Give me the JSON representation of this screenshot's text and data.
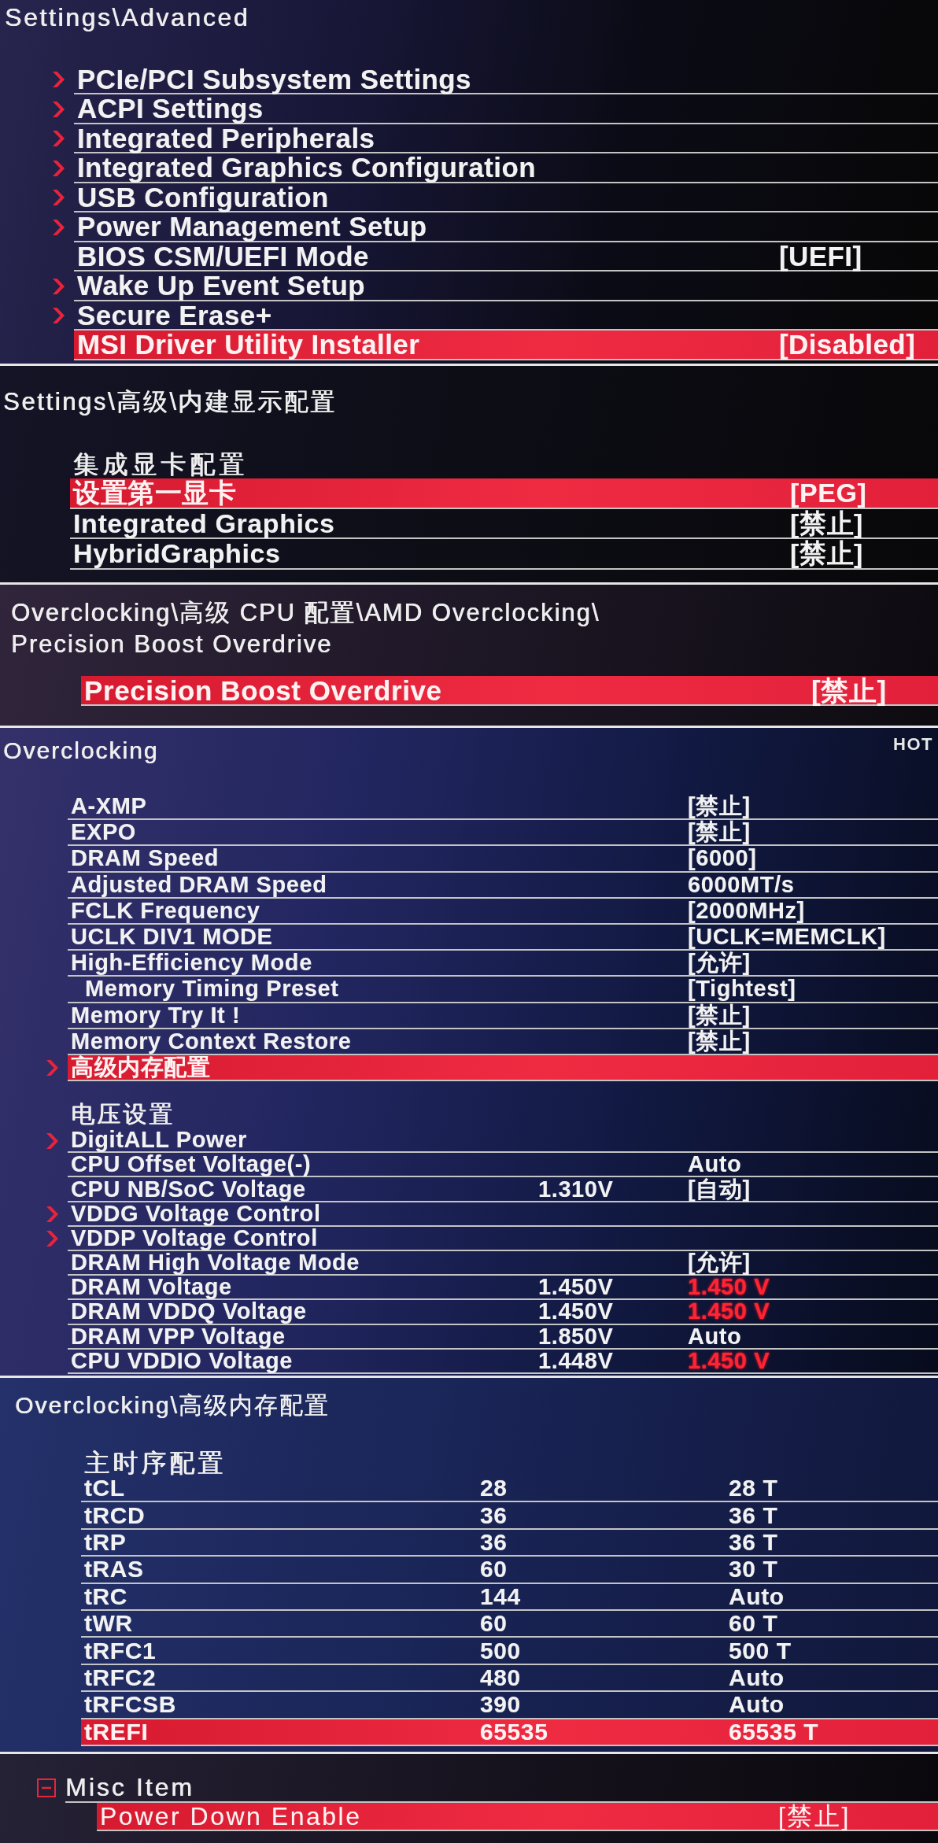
{
  "panels": [
    {
      "title_lines": [
        "Settings\\Advanced"
      ],
      "sections": [
        {
          "rows": [
            {
              "label": "PCIe/PCI Subsystem Settings",
              "submenu": true,
              "selected": false
            },
            {
              "label": "ACPI Settings",
              "submenu": true,
              "selected": false
            },
            {
              "label": "Integrated Peripherals",
              "submenu": true,
              "selected": false
            },
            {
              "label": "Integrated Graphics Configuration",
              "submenu": true,
              "selected": false
            },
            {
              "label": "USB Configuration",
              "submenu": true,
              "selected": false
            },
            {
              "label": "Power Management Setup",
              "submenu": true,
              "selected": false
            },
            {
              "label": "BIOS CSM/UEFI Mode",
              "submenu": false,
              "value": "[UEFI]",
              "selected": false
            },
            {
              "label": "Wake Up Event Setup",
              "submenu": true,
              "selected": false
            },
            {
              "label": "Secure Erase+",
              "submenu": true,
              "selected": false
            },
            {
              "label": "MSI Driver Utility Installer",
              "submenu": false,
              "value": "[Disabled]",
              "selected": true
            }
          ]
        }
      ]
    },
    {
      "title_lines": [
        "Settings\\高级\\内建显示配置"
      ],
      "sections": [
        {
          "heading": "集成显卡配置",
          "rows": [
            {
              "label": "设置第一显卡",
              "value": "[PEG]",
              "selected": true
            },
            {
              "label": "Integrated Graphics",
              "value": "[禁止]",
              "selected": false
            },
            {
              "label": "HybridGraphics",
              "value": "[禁止]",
              "selected": false
            }
          ]
        }
      ]
    },
    {
      "title_lines": [
        "Overclocking\\高级 CPU 配置\\AMD Overclocking\\",
        "Precision Boost Overdrive"
      ],
      "sections": [
        {
          "rows": [
            {
              "label": "Precision Boost Overdrive",
              "value": "[禁止]",
              "selected": true
            }
          ]
        }
      ]
    },
    {
      "title_lines": [
        "Overclocking"
      ],
      "badge": "HOT",
      "sections": [
        {
          "rows": [
            {
              "label": "A-XMP",
              "submenu": false,
              "value": "[禁止]",
              "selected": false
            },
            {
              "label": "EXPO",
              "submenu": false,
              "value": "[禁止]",
              "selected": false
            },
            {
              "label": "DRAM Speed",
              "submenu": false,
              "value": "[6000]",
              "selected": false
            },
            {
              "label": "Adjusted DRAM Speed",
              "submenu": false,
              "value": "6000MT/s",
              "selected": false
            },
            {
              "label": "FCLK Frequency",
              "submenu": false,
              "value": "[2000MHz]",
              "selected": false
            },
            {
              "label": "UCLK DIV1 MODE",
              "submenu": false,
              "value": "[UCLK=MEMCLK]",
              "selected": false
            },
            {
              "label": "High-Efficiency Mode",
              "submenu": false,
              "value": "[允许]",
              "selected": false,
              "children": [
                {
                  "label": "Memory Timing Preset",
                  "submenu": false,
                  "value": "[Tightest]",
                  "selected": false
                }
              ]
            },
            {
              "label": "Memory Try It !",
              "submenu": false,
              "value": "[禁止]",
              "selected": false
            },
            {
              "label": "Memory Context Restore",
              "submenu": false,
              "value": "[禁止]",
              "selected": false
            },
            {
              "label": "高级内存配置",
              "submenu": true,
              "selected": true
            }
          ]
        },
        {
          "heading": "电压设置",
          "rows": [
            {
              "label": "DigitALL Power",
              "submenu": true,
              "selected": false
            },
            {
              "label": "CPU Offset Voltage(-)",
              "submenu": false,
              "value": "Auto",
              "selected": false,
              "alert": false
            },
            {
              "label": "CPU NB/SoC Voltage",
              "submenu": false,
              "reading": "1.310V",
              "value": "[自动]",
              "selected": false,
              "alert": false
            },
            {
              "label": "VDDG Voltage Control",
              "submenu": true,
              "selected": false
            },
            {
              "label": "VDDP Voltage Control",
              "submenu": true,
              "selected": false
            },
            {
              "label": "DRAM High Voltage Mode",
              "submenu": false,
              "value": "[允许]",
              "selected": false,
              "alert": false
            },
            {
              "label": "DRAM Voltage",
              "submenu": false,
              "reading": "1.450V",
              "value": "1.450 V",
              "selected": false,
              "alert": true
            },
            {
              "label": "DRAM VDDQ Voltage",
              "submenu": false,
              "reading": "1.450V",
              "value": "1.450 V",
              "selected": false,
              "alert": true
            },
            {
              "label": "DRAM VPP Voltage",
              "submenu": false,
              "reading": "1.850V",
              "value": "Auto",
              "selected": false,
              "alert": false
            },
            {
              "label": "CPU VDDIO Voltage",
              "submenu": false,
              "reading": "1.448V",
              "value": "1.450 V",
              "selected": false,
              "alert": true
            }
          ]
        }
      ]
    },
    {
      "title_lines": [
        "Overclocking\\高级内存配置"
      ],
      "sections": [
        {
          "heading": "主时序配置",
          "rows": [
            {
              "label": "tCL",
              "reading": "28",
              "value": "28 T",
              "selected": false
            },
            {
              "label": "tRCD",
              "reading": "36",
              "value": "36 T",
              "selected": false
            },
            {
              "label": "tRP",
              "reading": "36",
              "value": "36 T",
              "selected": false
            },
            {
              "label": "tRAS",
              "reading": "60",
              "value": "30 T",
              "selected": false
            },
            {
              "label": "tRC",
              "reading": "144",
              "value": "Auto",
              "selected": false
            },
            {
              "label": "tWR",
              "reading": "60",
              "value": "60 T",
              "selected": false
            },
            {
              "label": "tRFC1",
              "reading": "500",
              "value": "500 T",
              "selected": false
            },
            {
              "label": "tRFC2",
              "reading": "480",
              "value": "Auto",
              "selected": false
            },
            {
              "label": "tRFCSB",
              "reading": "390",
              "value": "Auto",
              "selected": false
            },
            {
              "label": "tREFI",
              "reading": "65535",
              "value": "65535 T",
              "selected": true
            }
          ]
        }
      ]
    },
    {
      "sections": [
        {
          "heading": "Misc Item",
          "expanded": true,
          "rows": [
            {
              "label": "Power Down Enable",
              "value": "[禁止]",
              "selected": true
            }
          ]
        }
      ]
    }
  ]
}
